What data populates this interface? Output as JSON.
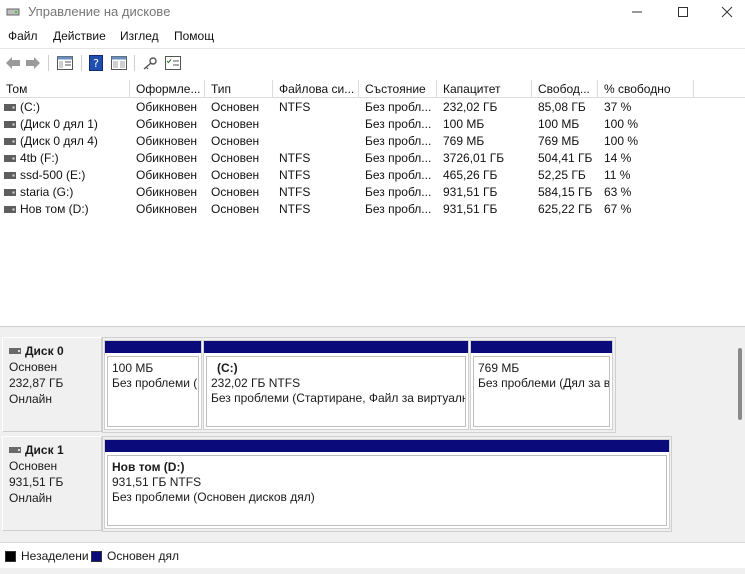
{
  "window": {
    "title": "Управление на дисковe"
  },
  "menu": [
    "Файл",
    "Действие",
    "Изглед",
    "Помощ"
  ],
  "volume_table": {
    "columns": [
      "Том",
      "Оформле...",
      "Тип",
      "Файлова си...",
      "Състояние",
      "Капацитет",
      "Свобод...",
      "% свободно"
    ],
    "rows": [
      [
        "(C:)",
        "Обикновен",
        "Основен",
        "NTFS",
        "Без пробл...",
        "232,02 ГБ",
        "85,08 ГБ",
        "37 %"
      ],
      [
        "(Диск 0 дял 1)",
        "Обикновен",
        "Основен",
        "",
        "Без пробл...",
        "100 МБ",
        "100 МБ",
        "100 %"
      ],
      [
        "(Диск 0 дял 4)",
        "Обикновен",
        "Основен",
        "",
        "Без пробл...",
        "769 МБ",
        "769 МБ",
        "100 %"
      ],
      [
        "4tb (F:)",
        "Обикновен",
        "Основен",
        "NTFS",
        "Без пробл...",
        "3726,01 ГБ",
        "504,41 ГБ",
        "14 %"
      ],
      [
        "ssd-500 (E:)",
        "Обикновен",
        "Основен",
        "NTFS",
        "Без пробл...",
        "465,26 ГБ",
        "52,25 ГБ",
        "11 %"
      ],
      [
        "staria (G:)",
        "Обикновен",
        "Основен",
        "NTFS",
        "Без пробл...",
        "931,51 ГБ",
        "584,15 ГБ",
        "63 %"
      ],
      [
        "Нов том (D:)",
        "Обикновен",
        "Основен",
        "NTFS",
        "Без пробл...",
        "931,51 ГБ",
        "625,22 ГБ",
        "67 %"
      ]
    ]
  },
  "disks": [
    {
      "name": "Диск 0",
      "type": "Основен",
      "size": "232,87 ГБ",
      "status": "Онлайн",
      "partitions": [
        {
          "title": "",
          "size": "100 МБ",
          "status": "Без проблеми ("
        },
        {
          "title": "(C:)",
          "size": "232,02 ГБ NTFS",
          "status": "Без проблеми (Стартиране, Файл за виртуалн"
        },
        {
          "title": "",
          "size": "769 МБ",
          "status": "Без проблеми (Дял за в"
        }
      ]
    },
    {
      "name": "Диск 1",
      "type": "Основен",
      "size": "931,51 ГБ",
      "status": "Онлайн",
      "partitions": [
        {
          "title": "Нов том  (D:)",
          "size": "931,51 ГБ NTFS",
          "status": "Без проблеми (Основен дисков дял)"
        }
      ]
    }
  ],
  "legend": [
    {
      "label": "Незаделени",
      "color": "#000000"
    },
    {
      "label": "Основен дял",
      "color": "#0a0a7a"
    }
  ],
  "colors": {
    "primary_partition": "#0a0a7a",
    "unallocated": "#000000"
  }
}
